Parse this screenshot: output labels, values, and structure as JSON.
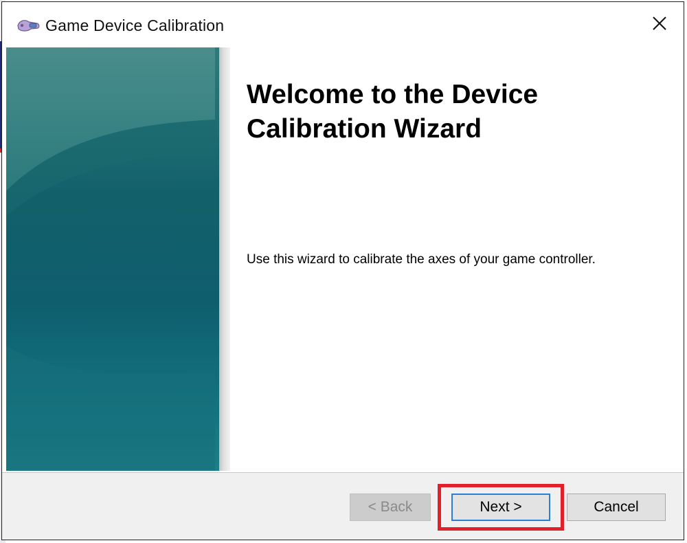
{
  "window": {
    "title": "Game Device Calibration",
    "app_icon": "game-controller-icon",
    "close_icon": "close-icon"
  },
  "main": {
    "heading_line1": "Welcome to the Device",
    "heading_line2": "Calibration Wizard",
    "description": "Use this wizard to calibrate the axes of your game controller."
  },
  "footer": {
    "back_label": "< Back",
    "next_label": "Next >",
    "cancel_label": "Cancel"
  },
  "colors": {
    "panel_teal": "#0f5e6e",
    "focus_blue": "#2b7ed7",
    "highlight_red": "#e0202a",
    "footer_bg": "#f0f0f0"
  }
}
